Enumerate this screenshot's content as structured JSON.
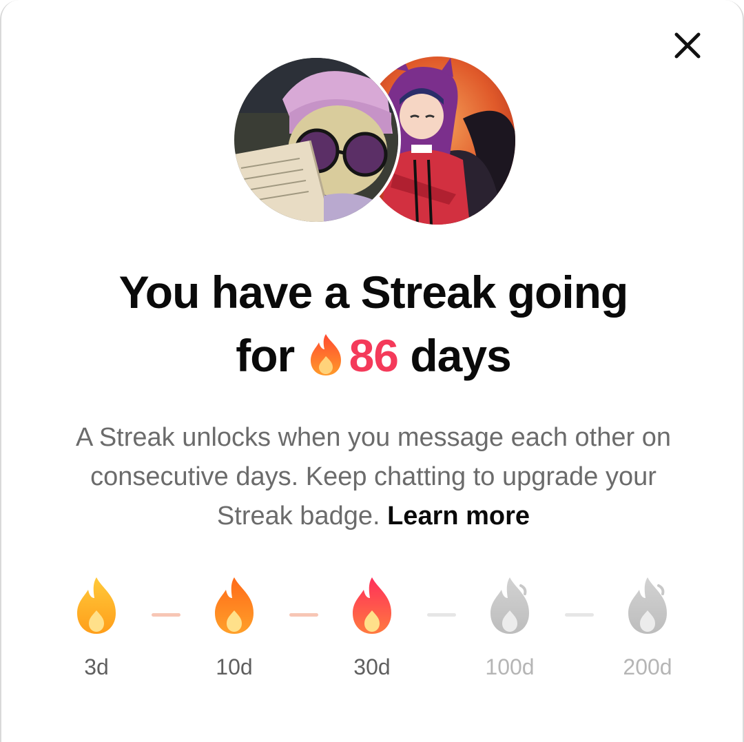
{
  "close": {
    "icon": "close-icon"
  },
  "avatars": [
    {
      "name": "avatar-left"
    },
    {
      "name": "avatar-right"
    }
  ],
  "title": {
    "line1": "You have a Streak going",
    "prefix": "for",
    "count": "86",
    "suffix": "days"
  },
  "description": {
    "text": "A Streak unlocks when you message each other on consecutive days. Keep chatting to upgrade your Streak badge.",
    "link": "Learn more"
  },
  "milestones": [
    {
      "label": "3d",
      "state": "achieved",
      "color": "#ffb020"
    },
    {
      "label": "10d",
      "state": "achieved",
      "color": "#ff8a1e"
    },
    {
      "label": "30d",
      "state": "achieved",
      "color": "#ff4a55"
    },
    {
      "label": "100d",
      "state": "locked",
      "color": "#c8c8c8"
    },
    {
      "label": "200d",
      "state": "locked",
      "color": "#c8c8c8"
    }
  ],
  "colors": {
    "accent": "#f43a5a",
    "connector_active": "#f7c6b5",
    "connector_inactive": "#e6e6e6"
  }
}
